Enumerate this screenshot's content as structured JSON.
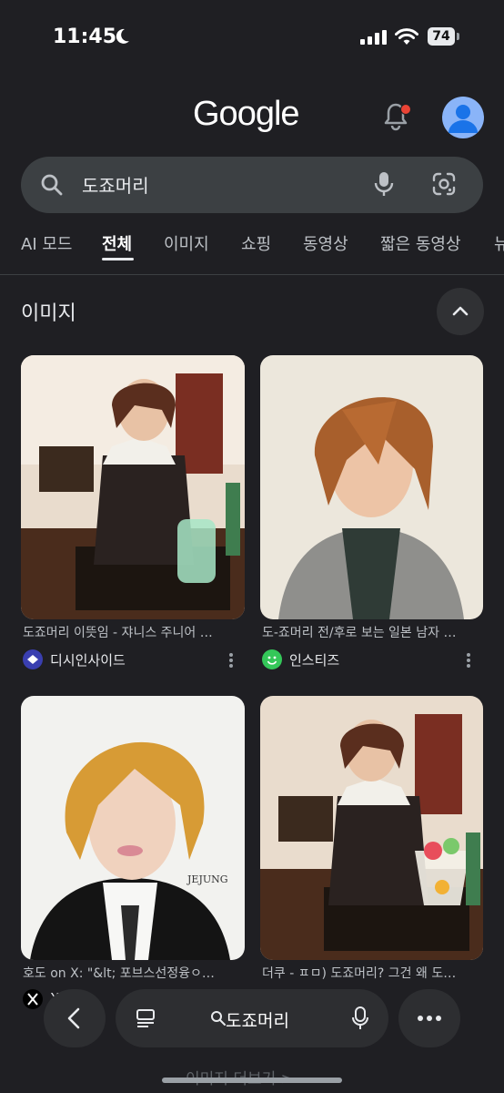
{
  "status_bar": {
    "time": "11:45",
    "battery": "74"
  },
  "header": {
    "logo": "Google"
  },
  "search": {
    "query": "도죠머리"
  },
  "tabs": [
    {
      "label": "AI 모드"
    },
    {
      "label": "전체"
    },
    {
      "label": "이미지"
    },
    {
      "label": "쇼핑"
    },
    {
      "label": "동영상"
    },
    {
      "label": "짧은 동영상"
    },
    {
      "label": "뉴"
    }
  ],
  "section": {
    "title": "이미지"
  },
  "results": [
    {
      "caption": "도죠머리 이뜻임 - 쟈니스 주니어 …",
      "source": "디시인사이드"
    },
    {
      "caption": "도-죠머리 전/후로 보는 일본 남자 …",
      "source": "인스티즈"
    },
    {
      "caption": "호도 on X: \"&lt; 포브스선정융ㅇ…",
      "source": "X"
    },
    {
      "caption": "더쿠 - ㅍㅁ) 도죠머리? 그건 왜 도…",
      "source": ""
    }
  ],
  "image_text": {
    "jejung": "JEJUNG"
  },
  "bottom_bar": {
    "query": "도죠머리",
    "more_images": "이미지 더보기  >"
  },
  "colors": {
    "background": "#1f1f23",
    "search_bg": "#3c4043",
    "accent_blue": "#8ab4f8",
    "notification_red": "#ea4335"
  }
}
